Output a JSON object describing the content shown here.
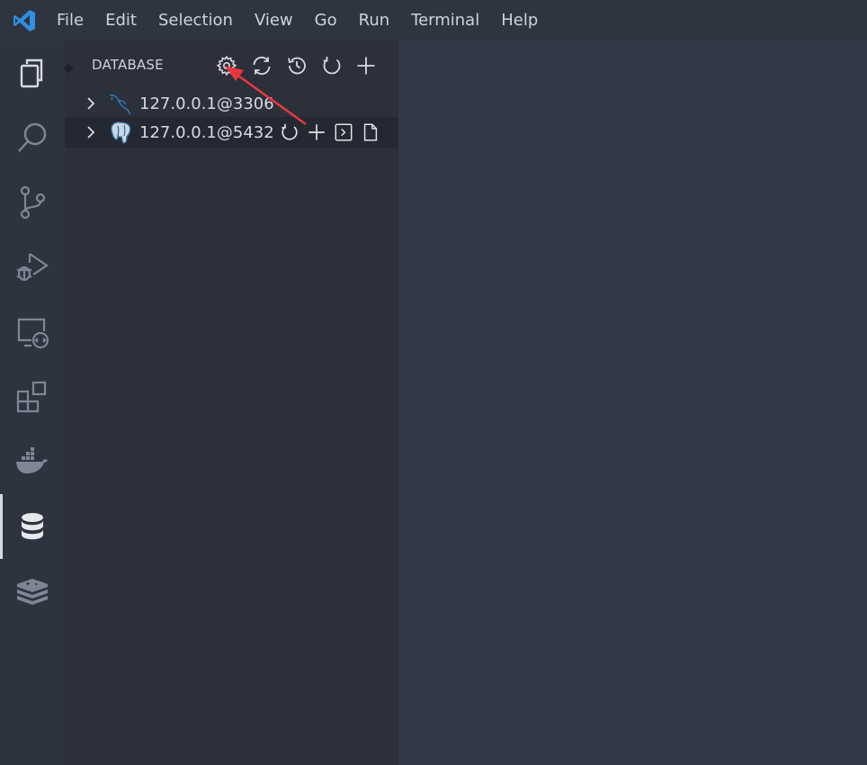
{
  "menu": {
    "items": [
      "File",
      "Edit",
      "Selection",
      "View",
      "Go",
      "Run",
      "Terminal",
      "Help"
    ]
  },
  "activity_bar": {
    "items": [
      "files-icon",
      "search-icon",
      "source-control-icon",
      "run-debug-icon",
      "remote-explorer-icon",
      "extensions-icon",
      "docker-icon",
      "database-icon",
      "redis-icon"
    ],
    "active": "database-icon"
  },
  "sidebar": {
    "title": "DATABASE",
    "toolbar_icons": [
      "gear-icon",
      "sync-icon",
      "history-icon",
      "refresh-icon",
      "add-icon"
    ],
    "connections": [
      {
        "label": "127.0.0.1@3306",
        "icon": "mysql-icon"
      },
      {
        "label": "127.0.0.1@5432",
        "icon": "postgresql-icon",
        "hover_actions": [
          "refresh-icon",
          "add-icon",
          "terminal-icon",
          "new-file-icon"
        ]
      }
    ]
  },
  "colors": {
    "background": "#333846",
    "sidebar": "#2b303b",
    "activity_bar": "#2e3340",
    "accent": "#3b9ae1",
    "annotation_arrow": "#e8383d"
  }
}
